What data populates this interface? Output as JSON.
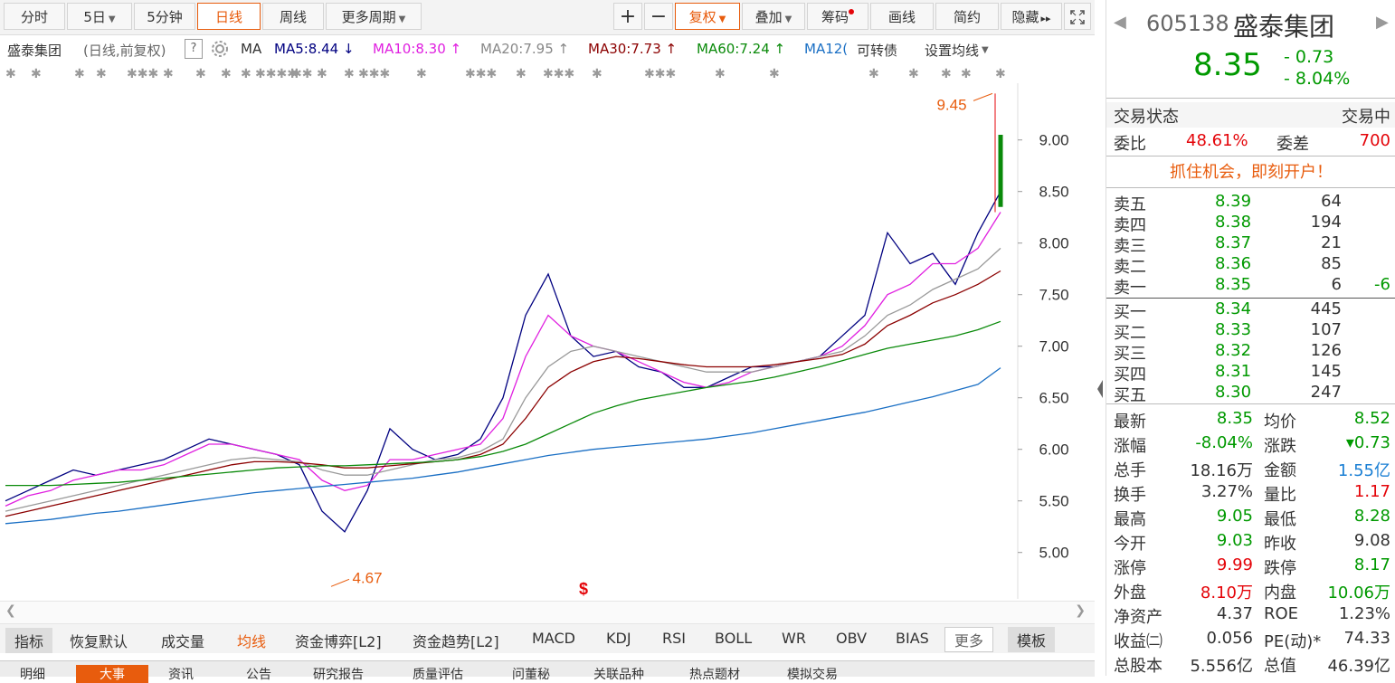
{
  "toolbar": {
    "tabs": [
      "分时",
      "5日",
      "5分钟",
      "日线",
      "周线",
      "更多周期"
    ],
    "right_buttons": [
      "+",
      "−",
      "复权",
      "叠加",
      "筹码",
      "画线",
      "简约",
      "隐藏"
    ],
    "more_arrow": "▸▸"
  },
  "ma_bar": {
    "title": "盛泰集团",
    "subtitle": "(日线,前复权)",
    "help": "?",
    "ma_label": "MA",
    "ma5": "MA5:8.44",
    "ma10": "MA10:8.30",
    "ma20": "MA20:7.95",
    "ma30": "MA30:7.73",
    "ma60": "MA60:7.24",
    "ma120": "MA12(",
    "convert": "可转债",
    "settings": "设置均线",
    "colors": {
      "ma5": "#000080",
      "ma10": "#e020e0",
      "ma20": "#888888",
      "ma30": "#8b0000",
      "ma60": "#0a8a0a",
      "ma120": "#1a6fc4"
    }
  },
  "chart_data": {
    "type": "candlestick",
    "yaxis": {
      "ticks": [
        "9.00",
        "8.50",
        "8.00",
        "7.50",
        "7.00",
        "6.50",
        "6.00",
        "5.50",
        "5.00"
      ],
      "min": 4.55,
      "max": 9.55
    },
    "annotations": [
      {
        "text": "9.45",
        "value": 9.45
      },
      {
        "text": "4.67",
        "value": 4.67
      }
    ],
    "event_marker": "$",
    "series": [
      {
        "name": "MA5",
        "values": [
          5.5,
          5.6,
          5.7,
          5.8,
          5.75,
          5.8,
          5.85,
          5.9,
          6.0,
          6.1,
          6.05,
          6.0,
          5.95,
          5.85,
          5.4,
          5.2,
          5.6,
          6.2,
          6.0,
          5.9,
          5.95,
          6.1,
          6.5,
          7.3,
          7.7,
          7.1,
          6.9,
          6.95,
          6.8,
          6.75,
          6.6,
          6.6,
          6.7,
          6.8,
          6.8,
          6.85,
          6.9,
          7.1,
          7.3,
          8.1,
          7.8,
          7.9,
          7.6,
          8.1,
          8.5
        ]
      },
      {
        "name": "MA10",
        "values": [
          5.45,
          5.55,
          5.6,
          5.7,
          5.75,
          5.8,
          5.8,
          5.85,
          5.95,
          6.05,
          6.05,
          6.0,
          5.95,
          5.9,
          5.7,
          5.6,
          5.65,
          5.9,
          5.9,
          5.95,
          6.0,
          6.05,
          6.3,
          6.9,
          7.3,
          7.1,
          7.0,
          6.95,
          6.85,
          6.75,
          6.65,
          6.6,
          6.65,
          6.75,
          6.8,
          6.85,
          6.9,
          7.0,
          7.2,
          7.5,
          7.6,
          7.8,
          7.8,
          7.95,
          8.3
        ]
      },
      {
        "name": "MA20",
        "values": [
          5.4,
          5.45,
          5.5,
          5.55,
          5.6,
          5.65,
          5.7,
          5.75,
          5.8,
          5.85,
          5.9,
          5.92,
          5.9,
          5.88,
          5.8,
          5.75,
          5.75,
          5.8,
          5.85,
          5.9,
          5.92,
          5.98,
          6.1,
          6.5,
          6.8,
          6.95,
          7.0,
          6.95,
          6.9,
          6.85,
          6.8,
          6.75,
          6.75,
          6.75,
          6.8,
          6.85,
          6.9,
          6.95,
          7.1,
          7.3,
          7.4,
          7.55,
          7.65,
          7.75,
          7.95
        ]
      },
      {
        "name": "MA30",
        "values": [
          5.35,
          5.4,
          5.45,
          5.5,
          5.55,
          5.6,
          5.65,
          5.7,
          5.75,
          5.8,
          5.85,
          5.88,
          5.88,
          5.87,
          5.85,
          5.82,
          5.82,
          5.84,
          5.86,
          5.88,
          5.9,
          5.95,
          6.05,
          6.3,
          6.6,
          6.75,
          6.85,
          6.9,
          6.88,
          6.85,
          6.82,
          6.8,
          6.8,
          6.8,
          6.82,
          6.85,
          6.88,
          6.92,
          7.02,
          7.2,
          7.3,
          7.42,
          7.5,
          7.6,
          7.73
        ]
      },
      {
        "name": "MA60",
        "values": [
          5.65,
          5.65,
          5.65,
          5.66,
          5.67,
          5.68,
          5.7,
          5.72,
          5.74,
          5.76,
          5.78,
          5.8,
          5.82,
          5.83,
          5.84,
          5.84,
          5.85,
          5.86,
          5.87,
          5.88,
          5.9,
          5.93,
          5.98,
          6.05,
          6.15,
          6.25,
          6.35,
          6.42,
          6.48,
          6.52,
          6.56,
          6.6,
          6.63,
          6.66,
          6.7,
          6.75,
          6.8,
          6.86,
          6.92,
          6.98,
          7.02,
          7.06,
          7.1,
          7.16,
          7.24
        ]
      },
      {
        "name": "MA120",
        "values": [
          5.28,
          5.3,
          5.32,
          5.35,
          5.38,
          5.4,
          5.43,
          5.46,
          5.49,
          5.52,
          5.55,
          5.58,
          5.6,
          5.62,
          5.64,
          5.66,
          5.68,
          5.7,
          5.72,
          5.75,
          5.78,
          5.82,
          5.86,
          5.9,
          5.94,
          5.97,
          6.0,
          6.02,
          6.04,
          6.06,
          6.08,
          6.1,
          6.13,
          6.16,
          6.2,
          6.24,
          6.28,
          6.32,
          6.36,
          6.41,
          6.46,
          6.51,
          6.57,
          6.63,
          6.79
        ]
      }
    ]
  },
  "indicators": [
    "指标",
    "恢复默认",
    "成交量",
    "均线",
    "资金博弈[L2]",
    "资金趋势[L2]",
    "MACD",
    "KDJ",
    "RSI",
    "BOLL",
    "WR",
    "OBV",
    "BIAS",
    "更多",
    "模板"
  ],
  "bottom_tabs": [
    "明细",
    "大事",
    "资讯",
    "公告",
    "研究报告",
    "质量评估",
    "问董秘",
    "关联品种",
    "热点题材",
    "模拟交易"
  ],
  "quote": {
    "code": "605138",
    "name": "盛泰集团",
    "price": "8.35",
    "change": "- 0.73",
    "change_pct": "- 8.04%",
    "status_label": "交易状态",
    "status_value": "交易中",
    "weibi_label": "委比",
    "weibi_value": "48.61%",
    "weicha_label": "委差",
    "weicha_value": "700",
    "promo": "抓住机会，即刻开户！",
    "asks": [
      {
        "label": "卖五",
        "price": "8.39",
        "vol": "64",
        "diff": ""
      },
      {
        "label": "卖四",
        "price": "8.38",
        "vol": "194",
        "diff": ""
      },
      {
        "label": "卖三",
        "price": "8.37",
        "vol": "21",
        "diff": ""
      },
      {
        "label": "卖二",
        "price": "8.36",
        "vol": "85",
        "diff": ""
      },
      {
        "label": "卖一",
        "price": "8.35",
        "vol": "6",
        "diff": "-6"
      }
    ],
    "bids": [
      {
        "label": "买一",
        "price": "8.34",
        "vol": "445"
      },
      {
        "label": "买二",
        "price": "8.33",
        "vol": "107"
      },
      {
        "label": "买三",
        "price": "8.32",
        "vol": "126"
      },
      {
        "label": "买四",
        "price": "8.31",
        "vol": "145"
      },
      {
        "label": "买五",
        "price": "8.30",
        "vol": "247"
      }
    ],
    "stats": [
      {
        "l1": "最新",
        "v1": "8.35",
        "c1": "green",
        "l2": "均价",
        "v2": "8.52",
        "c2": "green"
      },
      {
        "l1": "涨幅",
        "v1": "-8.04%",
        "c1": "green",
        "l2": "涨跌",
        "v2": "▾0.73",
        "c2": "green"
      },
      {
        "l1": "总手",
        "v1": "18.16万",
        "c1": "",
        "l2": "金额",
        "v2": "1.55亿",
        "c2": "blue"
      },
      {
        "l1": "换手",
        "v1": "3.27%",
        "c1": "",
        "l2": "量比",
        "v2": "1.17",
        "c2": "red"
      },
      {
        "l1": "最高",
        "v1": "9.05",
        "c1": "green",
        "l2": "最低",
        "v2": "8.28",
        "c2": "green"
      },
      {
        "l1": "今开",
        "v1": "9.03",
        "c1": "green",
        "l2": "昨收",
        "v2": "9.08",
        "c2": ""
      },
      {
        "l1": "涨停",
        "v1": "9.99",
        "c1": "red",
        "l2": "跌停",
        "v2": "8.17",
        "c2": "green"
      },
      {
        "l1": "外盘",
        "v1": "8.10万",
        "c1": "red",
        "l2": "内盘",
        "v2": "10.06万",
        "c2": "green"
      },
      {
        "l1": "净资产",
        "v1": "4.37",
        "c1": "",
        "l2": "ROE",
        "v2": "1.23%",
        "c2": ""
      },
      {
        "l1": "收益㈡",
        "v1": "0.056",
        "c1": "",
        "l2": "PE(动)*",
        "v2": "74.33",
        "c2": ""
      },
      {
        "l1": "总股本",
        "v1": "5.556亿",
        "c1": "",
        "l2": "总值",
        "v2": "46.39亿",
        "c2": ""
      }
    ]
  }
}
